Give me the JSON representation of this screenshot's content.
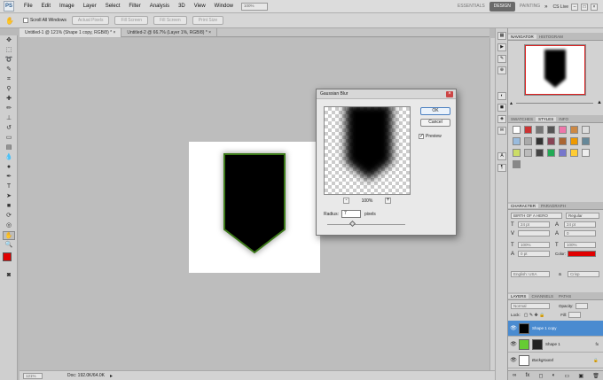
{
  "app": {
    "logo": "PS"
  },
  "menubar": {
    "items": [
      "File",
      "Edit",
      "Image",
      "Layer",
      "Select",
      "Filter",
      "Analysis",
      "3D",
      "View",
      "Window",
      "Help"
    ],
    "zoom": "100%",
    "workspaces": [
      "ESSENTIALS",
      "DESIGN",
      "PAINTING"
    ],
    "active_workspace": "DESIGN",
    "cs_live": "CS Live"
  },
  "options": {
    "scroll_all_windows": "Scroll All Windows",
    "buttons": [
      "Actual Pixels",
      "Fill Screen",
      "Fill Screen",
      "Print Size"
    ]
  },
  "tabs": [
    {
      "label": "Untitled-1 @ 121% (Shape 1 copy, RGB/8) *",
      "active": true
    },
    {
      "label": "Untitled-2 @ 66.7% (Layer 1%, RGB/8) *",
      "active": false
    }
  ],
  "status": {
    "zoom": "121%",
    "doc": "Doc: 192.0K/64.0K"
  },
  "dialog": {
    "title": "Gaussian Blur",
    "ok": "OK",
    "cancel": "Cancel",
    "preview_label": "Preview",
    "preview_checked": true,
    "zoom": "100%",
    "minus": "-",
    "plus": "+",
    "radius_label": "Radius:",
    "radius_value": "7",
    "radius_unit": "pixels"
  },
  "navigator": {
    "tabs": [
      "NAVIGATOR",
      "HISTOGRAM"
    ]
  },
  "swatches": {
    "tabs": [
      "SWATCHES",
      "STYLES",
      "INFO"
    ]
  },
  "character": {
    "tabs": [
      "CHARACTER",
      "PARAGRAPH"
    ],
    "font": "BIRTH OF A HERO",
    "style": "Regular",
    "size": "24 pt",
    "leading": "24 pt",
    "tracking": "0",
    "vscale": "100%",
    "hscale": "100%",
    "baseline": "0 pt",
    "color_label": "Color:",
    "language": "English: USA",
    "aa": "Crisp",
    "color": "#e00000"
  },
  "layers": {
    "tabs": [
      "LAYERS",
      "CHANNELS",
      "PATHS"
    ],
    "blend": "Normal",
    "opacity_label": "Opacity:",
    "lock_label": "Lock:",
    "fill_label": "Fill:",
    "items": [
      {
        "name": "Shape 1 copy",
        "selected": true
      },
      {
        "name": "Shape 1",
        "selected": false
      },
      {
        "name": "Background",
        "selected": false
      }
    ],
    "fx": "fx"
  },
  "colors": {
    "accent": "#4a8bd0",
    "foreground": "#e00000",
    "background": "#000000",
    "glow": "#3d7a1a"
  }
}
